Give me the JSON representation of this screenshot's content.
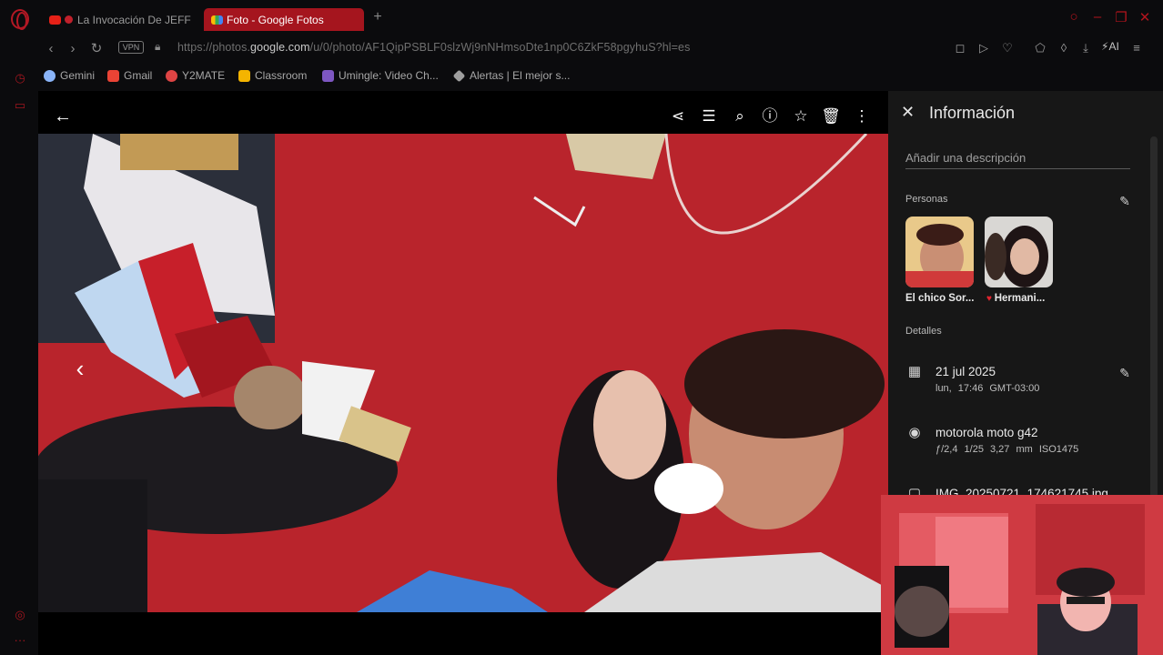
{
  "browser": {
    "tabs": [
      {
        "label": "La Invocación De JEFF",
        "active": false
      },
      {
        "label": "Foto - Google Fotos",
        "active": true
      }
    ],
    "address": {
      "url_prefix": "https://photos.",
      "url_host": "google.com",
      "url_path": "/u/0/photo/AF1QipPSBLF0slzWj9nNHmsoDte1np0C6ZkF58pgyhuS?hl=es",
      "vpn_label": "VPN"
    },
    "ai_label": "AI",
    "bookmarks": [
      {
        "label": "Gemini",
        "color": "#8ab4f8"
      },
      {
        "label": "Gmail",
        "color": "#ea4335"
      },
      {
        "label": "Y2MATE",
        "color": "#d44"
      },
      {
        "label": "Classroom",
        "color": "#f4b400"
      },
      {
        "label": "Umingle: Video Ch...",
        "color": "#7e57c2"
      },
      {
        "label": "Alertas | El mejor s...",
        "color": "#9e9e9e"
      }
    ],
    "accent": "#a5151e"
  },
  "viewer": {
    "toolbar": [
      "share-icon",
      "edit-icon",
      "zoom-icon",
      "info-icon",
      "star-icon",
      "delete-icon",
      "more-icon"
    ]
  },
  "info_panel": {
    "title": "Información",
    "description_placeholder": "Añadir una descripción",
    "people_heading": "Personas",
    "people": [
      {
        "name": "El chico Sor..."
      },
      {
        "name": "Hermani..."
      }
    ],
    "details_heading": "Detalles",
    "date": {
      "main": "21 jul 2025",
      "sub": "lun, 17:46  GMT-03:00"
    },
    "camera": {
      "main": "motorola moto g42",
      "sub": "ƒ/2,4  1/25  3,27 mm  ISO1475"
    },
    "file": {
      "main": "IMG_20250721_174621745.jpg"
    }
  }
}
